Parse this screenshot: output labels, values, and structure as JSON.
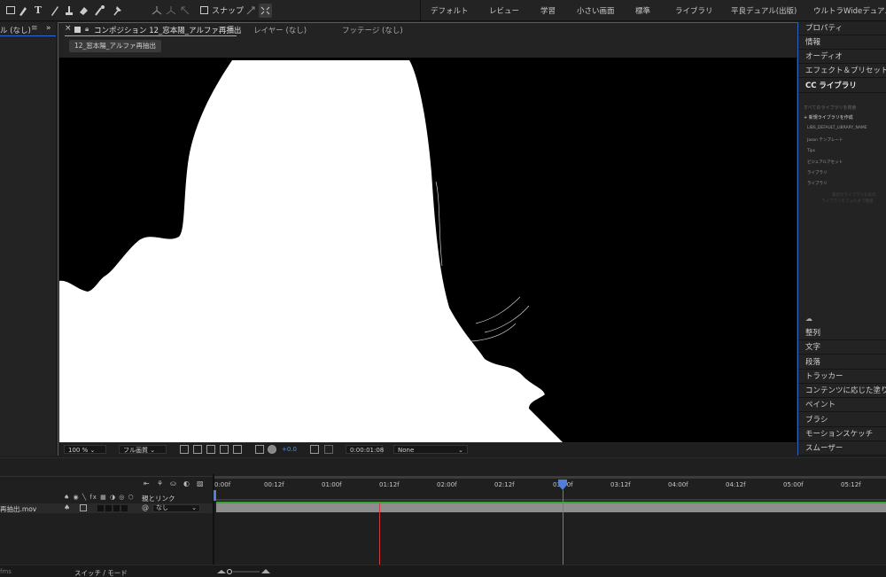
{
  "toolbar": {
    "snap_label": "スナップ",
    "workspaces": [
      "デフォルト",
      "レビュー",
      "学習",
      "小さい画面",
      "標準",
      "ライブラリ",
      "平良デュアル(出版)",
      "ウルトラWideデュアル"
    ]
  },
  "project_panel": {
    "title": "ル (なし)"
  },
  "composition_panel": {
    "tab_comp": "コンポジション 12_窓本陽_アルファ再抽出",
    "tab_layer": "レイヤー (なし)",
    "tab_footage": "フッテージ (なし)",
    "breadcrumb": "12_窓本陽_アルファ再抽出",
    "controls": {
      "zoom": "100 %",
      "resolution": "フル画質",
      "exposure": "+0.0",
      "timecode": "0:00:01:08",
      "renderer": "None"
    }
  },
  "right_panel": {
    "items": [
      "プロパティ",
      "情報",
      "オーディオ",
      "エフェクト＆プリセット",
      "CC ライブラリ"
    ],
    "library": {
      "search_placeholder": "すべてのライブラリを検索",
      "create_label": "+ 新規ライブラリを作成",
      "rows": [
        "LIBS_DEFAULT_LIBRARY_NAME",
        "Jason テンプレート",
        "Tips",
        "ビジュアルアセット",
        "ライブラリ",
        "ライブラリ"
      ],
      "note_lines": [
        "最近のライブラリを表示",
        "ライブラリをフォルダで整理"
      ]
    },
    "bottom_items": [
      "整列",
      "文字",
      "段落",
      "トラッカー",
      "コンテンツに応じた塗りつぶし",
      "ペイント",
      "ブラシ",
      "モーションスケッチ",
      "スムーザー"
    ]
  },
  "timeline": {
    "parent_label": "親とリンク",
    "layer_name": "再抽出.mov",
    "parent_value": "なし",
    "switch_mode_label": "スイッチ / モード",
    "fps_label": "fms",
    "ruler_ticks": [
      "0:00f",
      "00:12f",
      "01:00f",
      "01:12f",
      "02:00f",
      "02:12f",
      "03:00f",
      "03:12f",
      "04:00f",
      "04:12f",
      "05:00f",
      "05:12f"
    ]
  }
}
